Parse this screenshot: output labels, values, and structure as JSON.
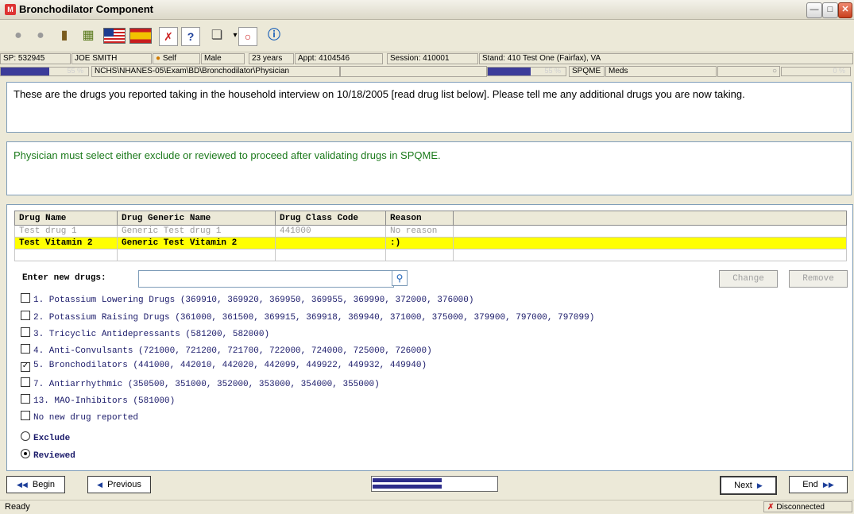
{
  "window": {
    "title": "Bronchodilator Component",
    "app_icon": "M"
  },
  "toolbar": {
    "icons": [
      "people-icon",
      "person-icon",
      "book-icon",
      "calculator-icon",
      "us-flag-icon",
      "spain-flag-icon",
      "cancel-x-icon",
      "help-icon",
      "windows-icon",
      "dropdown-icon",
      "record-icon",
      "info-icon"
    ]
  },
  "status_row1": {
    "sp": "SP: 532945",
    "name": "JOE SMITH",
    "self": "Self",
    "gender": "Male",
    "age": "23 years",
    "appt": "Appt: 4104546",
    "session": "Session: 410001",
    "stand": "Stand: 410 Test One (Fairfax), VA"
  },
  "status_row2": {
    "progress1": 0.55,
    "progress1_label": "55 %",
    "path": "NCHS\\NHANES-05\\Exam\\BD\\Bronchodilator\\Physician",
    "progress2": 0.55,
    "progress2_label": "55 %",
    "spqme": "SPQME",
    "meds": "Meds",
    "progress3_label": "0 %"
  },
  "question_text": "These are the drugs you reported taking in the household interview on 10/18/2005 [read drug list below]. Please tell me any additional drugs you are now taking.",
  "instruction_text": "Physician must select either exclude or reviewed to proceed after validating drugs in SPQME.",
  "drug_grid": {
    "headers": [
      "Drug Name",
      "Drug Generic Name",
      "Drug Class Code",
      "Reason"
    ],
    "rows": [
      [
        "Test drug 1",
        "Generic Test drug 1",
        "441000",
        "No reason"
      ],
      [
        "Test Vitamin 2",
        "Generic Test Vitamin 2",
        "",
        ":)"
      ]
    ]
  },
  "entry": {
    "label": "Enter new drugs:",
    "value": "",
    "change_label": "Change",
    "remove_label": "Remove"
  },
  "checkboxes": [
    {
      "label": "1. Potassium Lowering Drugs (369910, 369920, 369950, 369955, 369990, 372000, 376000)",
      "checked": false
    },
    {
      "label": "2. Potassium Raising Drugs (361000, 361500, 369915, 369918, 369940, 371000, 375000, 379900, 797000, 797099)",
      "checked": false
    },
    {
      "label": "3. Tricyclic Antidepressants (581200, 582000)",
      "checked": false
    },
    {
      "label": "4. Anti-Convulsants (721000, 721200, 721700, 722000, 724000, 725000, 726000)",
      "checked": false
    },
    {
      "label": "5. Bronchodilators (441000, 442010, 442020, 442099, 449922, 449932, 449940)",
      "checked": true
    },
    {
      "label": "7. Antiarrhythmic (350500, 351000, 352000, 353000, 354000, 355000)",
      "checked": false
    },
    {
      "label": "13. MAO-Inhibitors (581000)",
      "checked": false
    },
    {
      "label": "No new drug reported",
      "checked": false
    }
  ],
  "radios": [
    {
      "label": "Exclude",
      "selected": false
    },
    {
      "label": "Reviewed",
      "selected": true
    }
  ],
  "nav": {
    "begin": "Begin",
    "previous": "Previous",
    "next": "Next",
    "end": "End"
  },
  "statusbar": {
    "ready": "Ready",
    "connection": "Disconnected"
  },
  "colors": {
    "instruction": "#1b7a1b",
    "highlight_row": "#ffff00",
    "progress": "#3c3c9a"
  }
}
